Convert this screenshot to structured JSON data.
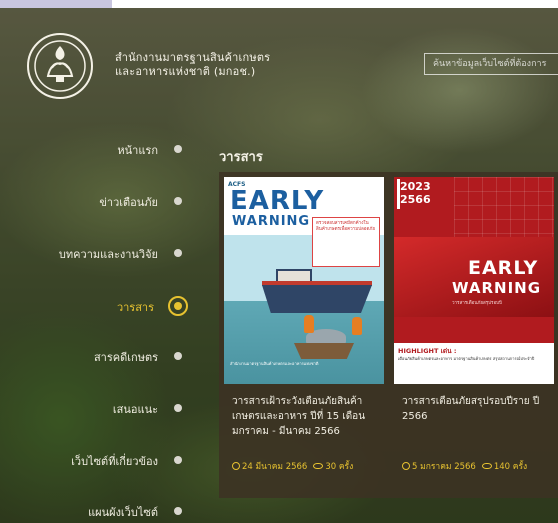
{
  "header": {
    "org_name_line1": "สำนักงานมาตรฐานสินค้าเกษตร",
    "org_name_line2": "และอาหารแห่งชาติ (มกอช.)",
    "search_placeholder": "ค้นหาข้อมูลเว็บไซต์ที่ต้องการ"
  },
  "nav": {
    "items": [
      {
        "label": "หน้าแรก",
        "active": false
      },
      {
        "label": "ข่าวเตือนภัย",
        "active": false
      },
      {
        "label": "บทความและงานวิจัย",
        "active": false
      },
      {
        "label": "วารสาร",
        "active": true
      },
      {
        "label": "สารคดีเกษตร",
        "active": false
      },
      {
        "label": "เสนอแนะ",
        "active": false
      },
      {
        "label": "เว็บไซต์ที่เกี่ยวข้อง",
        "active": false
      },
      {
        "label": "แผนผังเว็บไซต์",
        "active": false
      }
    ]
  },
  "main": {
    "section_title": "วารสาร",
    "cards": [
      {
        "title": "วารสารเฝ้าระวังเตือนภัยสินค้าเกษตรและอาหาร ปีที่ 15 เดือนมกราคม - มีนาคม 2566",
        "date": "24 มีนาคม 2566",
        "views": "30 ครั้ง",
        "cover": {
          "brand": "ACFS",
          "early": "EARLY",
          "warning": "WARNING",
          "box_text": "ตรวจสอบสารเคมีตกค้างในสินค้าเกษตรเพื่อความปลอดภัย",
          "footer_text": "สำนักงานมาตรฐานสินค้าเกษตรและอาหารแห่งชาติ"
        }
      },
      {
        "title": "วารสารเตือนภัยสรุปรอบปีราย ปี 2566",
        "date": "5 มกราคม 2566",
        "views": "140 ครั้ง",
        "cover": {
          "year_ad": "2023",
          "year_be": "2566",
          "early": "EARLY",
          "warning": "WARNING",
          "sub": "วารสารเตือนภัยสรุปรอบปี",
          "highlight": "HIGHLIGHT เด่น :",
          "bottom_text": "เตือนภัยสินค้าเกษตรและอาหาร มาตรฐานสินค้าเกษตร สรุปสถานการณ์ประจำปี"
        }
      }
    ]
  },
  "colors": {
    "accent": "#e7c230",
    "text_light": "#f1eee2",
    "card_bg": "#3c3223",
    "cover2_red": "#b11b1f",
    "cover1_blue": "#1c5fa0"
  }
}
